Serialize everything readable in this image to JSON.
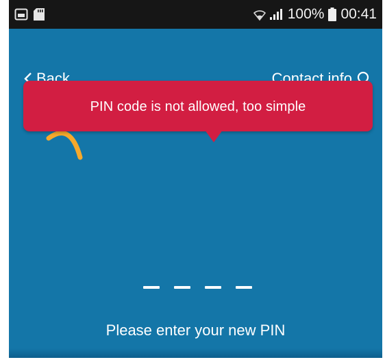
{
  "status_bar": {
    "left_icons": [
      "gallery-icon",
      "sd-card-icon"
    ],
    "right_icons": [
      "wifi-icon",
      "signal-icon",
      "battery-icon"
    ],
    "battery_percent": "100%",
    "time": "00:41"
  },
  "header": {
    "back_label": "Back",
    "contact_label": "Contact info",
    "back_icon": "chevron-left-icon",
    "contact_icon": "search-icon"
  },
  "toast": {
    "message": "PIN code is not allowed, too simple"
  },
  "pin_entry": {
    "slots": 4,
    "prompt": "Please enter your new PIN"
  },
  "colors": {
    "background": "#1476a8",
    "status_bar": "#161616",
    "toast": "#d21e42",
    "accent": "#f6a92c",
    "text": "#ffffff"
  }
}
